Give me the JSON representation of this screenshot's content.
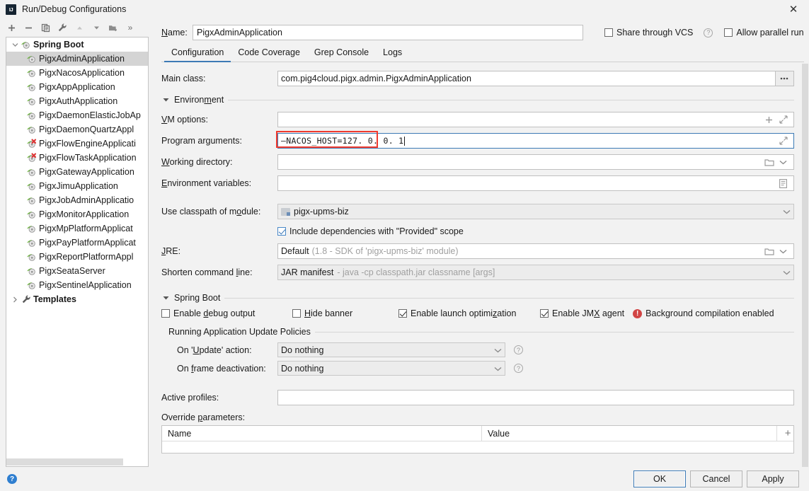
{
  "window": {
    "title": "Run/Debug Configurations",
    "logo_icon": "intellij-idea-logo",
    "close_icon": "close-icon"
  },
  "toolbar": {
    "add_label": "+",
    "remove_label": "−",
    "copy_icon": "copy-icon",
    "edit_templates_icon": "wrench-icon",
    "move_up_icon": "arrow-up-icon",
    "move_down_icon": "arrow-down-icon",
    "folder_icon": "new-folder-icon",
    "more_label": "»"
  },
  "sidebar": {
    "groups": [
      {
        "label": "Spring Boot",
        "icon": "spring-boot-icon",
        "expanded": true,
        "twisty": "∨",
        "items": [
          {
            "label": "PigxAdminApplication",
            "icon": "spring-boot-icon",
            "selected": true,
            "error": false
          },
          {
            "label": "PigxNacosApplication",
            "icon": "spring-boot-icon",
            "selected": false,
            "error": false
          },
          {
            "label": "PigxAppApplication",
            "icon": "spring-boot-icon",
            "selected": false,
            "error": false
          },
          {
            "label": "PigxAuthApplication",
            "icon": "spring-boot-icon",
            "selected": false,
            "error": false
          },
          {
            "label": "PigxDaemonElasticJobAp",
            "icon": "spring-boot-icon",
            "selected": false,
            "error": false
          },
          {
            "label": "PigxDaemonQuartzAppl",
            "icon": "spring-boot-icon",
            "selected": false,
            "error": false
          },
          {
            "label": "PigxFlowEngineApplicati",
            "icon": "spring-boot-icon",
            "selected": false,
            "error": true
          },
          {
            "label": "PigxFlowTaskApplication",
            "icon": "spring-boot-icon",
            "selected": false,
            "error": true
          },
          {
            "label": "PigxGatewayApplication",
            "icon": "spring-boot-icon",
            "selected": false,
            "error": false
          },
          {
            "label": "PigxJimuApplication",
            "icon": "spring-boot-icon",
            "selected": false,
            "error": false
          },
          {
            "label": "PigxJobAdminApplicatio",
            "icon": "spring-boot-icon",
            "selected": false,
            "error": false
          },
          {
            "label": "PigxMonitorApplication",
            "icon": "spring-boot-icon",
            "selected": false,
            "error": false
          },
          {
            "label": "PigxMpPlatformApplicat",
            "icon": "spring-boot-icon",
            "selected": false,
            "error": false
          },
          {
            "label": "PigxPayPlatformApplicat",
            "icon": "spring-boot-icon",
            "selected": false,
            "error": false
          },
          {
            "label": "PigxReportPlatformAppl",
            "icon": "spring-boot-icon",
            "selected": false,
            "error": false
          },
          {
            "label": "PigxSeataServer",
            "icon": "spring-boot-icon",
            "selected": false,
            "error": false
          },
          {
            "label": "PigxSentinelApplication",
            "icon": "spring-boot-icon",
            "selected": false,
            "error": false
          }
        ]
      }
    ],
    "templates": {
      "label": "Templates",
      "icon": "wrench-icon",
      "twisty": "›"
    }
  },
  "name_field": {
    "label": "Name:",
    "value": "PigxAdminApplication",
    "placeholder": ""
  },
  "top_options": {
    "share_vcs": {
      "label": "Share through VCS",
      "checked": false
    },
    "share_vcs_help_icon": "help-icon",
    "allow_parallel": {
      "label": "Allow parallel run",
      "checked": false
    }
  },
  "tabs": [
    {
      "label": "Configuration",
      "active": true
    },
    {
      "label": "Code Coverage",
      "active": false
    },
    {
      "label": "Grep Console",
      "active": false
    },
    {
      "label": "Logs",
      "active": false
    }
  ],
  "form": {
    "main_class": {
      "label": "Main class:",
      "value": "com.pig4cloud.pigx.admin.PigxAdminApplication",
      "browse_button": "..."
    },
    "environment_section": {
      "title": "Environment",
      "expanded": true,
      "triangle": "▼"
    },
    "vm_options": {
      "label": "VM options:",
      "value": "",
      "add_icon": "plus-icon",
      "expand_icon": "expand-icon"
    },
    "program_arguments": {
      "label": "Program arguments:",
      "value": "—NACOS_HOST=127. 0. 0. 1",
      "expand_icon": "expand-icon",
      "focused": true,
      "annotation_color": "#f03a2e"
    },
    "working_directory": {
      "label": "Working directory:",
      "value": "",
      "folder_icon": "folder-icon",
      "chevron_icon": "chevron-down-icon"
    },
    "environment_variables": {
      "label": "Environment variables:",
      "value": "",
      "list_icon": "list-icon"
    },
    "use_classpath": {
      "label": "Use classpath of module:",
      "value": "pigx-upms-biz",
      "module_icon": "module-icon",
      "chevron_icon": "chevron-down-icon"
    },
    "include_provided": {
      "label": "Include dependencies with \"Provided\" scope",
      "checked": true
    },
    "jre": {
      "label": "JRE:",
      "value": "Default",
      "hint": "(1.8 - SDK of 'pigx-upms-biz' module)",
      "folder_icon": "folder-icon",
      "chevron_icon": "chevron-down-icon"
    },
    "shorten_command_line": {
      "label": "Shorten command line:",
      "value": "JAR manifest",
      "hint": "- java -cp classpath.jar classname [args]",
      "chevron_icon": "chevron-down-icon"
    },
    "spring_boot_section": {
      "title": "Spring Boot",
      "expanded": true,
      "triangle": "▼"
    },
    "spring_boot_options": [
      {
        "label": "Enable debug output",
        "checked": false
      },
      {
        "label": "Hide banner",
        "checked": false
      },
      {
        "label": "Enable launch optimization",
        "checked": true
      },
      {
        "label": "Enable JMX agent",
        "checked": true
      }
    ],
    "background_compilation": {
      "icon": "error-icon",
      "label": "Background compilation enabled",
      "color": "#d14545"
    },
    "update_policies_section": {
      "title": "Running Application Update Policies"
    },
    "on_update_action": {
      "label": "On 'Update' action:",
      "value": "Do nothing",
      "chevron_icon": "chevron-down-icon",
      "help_icon": "help-icon"
    },
    "on_frame_deactivation": {
      "label": "On frame deactivation:",
      "value": "Do nothing",
      "chevron_icon": "chevron-down-icon",
      "help_icon": "help-icon"
    },
    "active_profiles": {
      "label": "Active profiles:",
      "value": ""
    },
    "override_parameters": {
      "label": "Override parameters:",
      "columns": [
        "Name",
        "Value"
      ],
      "rows": [],
      "add_button": "+"
    }
  },
  "footer": {
    "help_icon": "help-icon",
    "buttons": [
      {
        "label": "OK",
        "default": true
      },
      {
        "label": "Cancel",
        "default": false
      },
      {
        "label": "Apply",
        "default": false
      }
    ]
  }
}
